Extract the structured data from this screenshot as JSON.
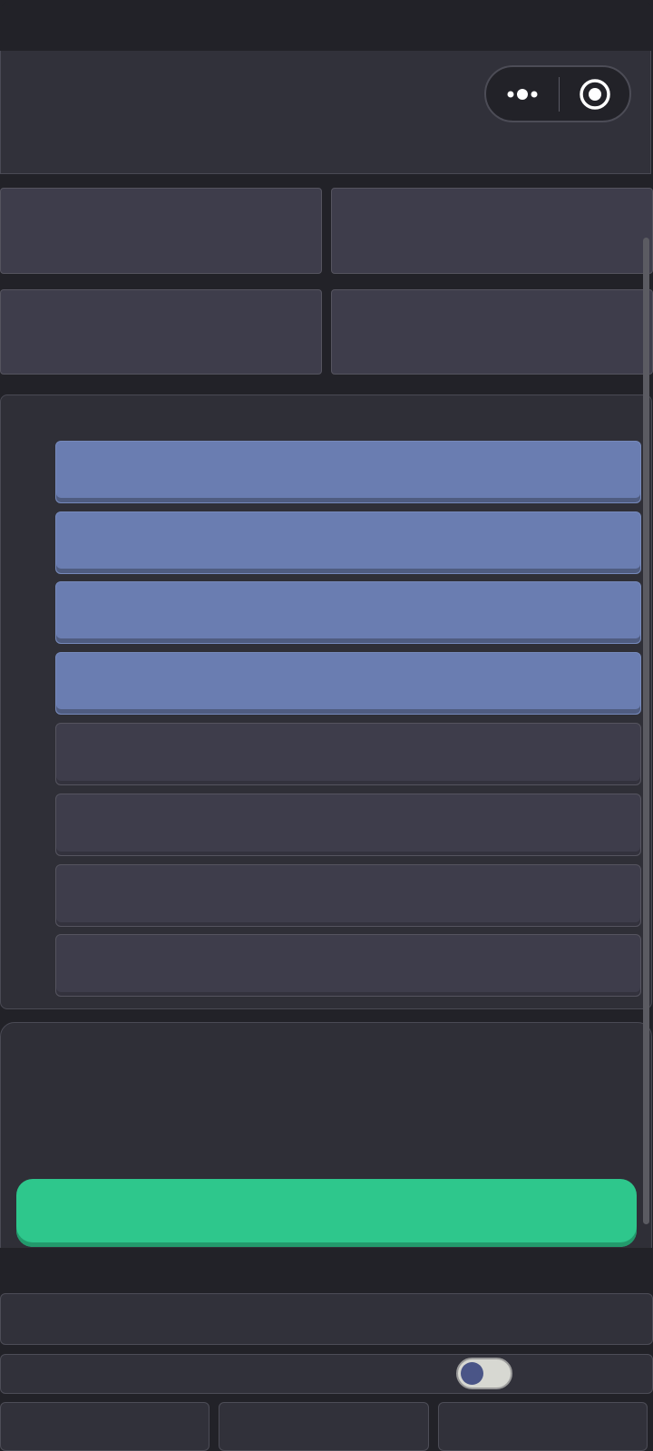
{
  "status_bar": {},
  "header": {
    "more_icon": "more-dots-icon",
    "close_icon": "target-circle-icon"
  },
  "tiles": [
    {},
    {},
    {},
    {}
  ],
  "list": {
    "rows": [
      {
        "state": "active"
      },
      {
        "state": "active"
      },
      {
        "state": "active"
      },
      {
        "state": "active"
      },
      {
        "state": "inactive"
      },
      {
        "state": "inactive"
      },
      {
        "state": "inactive"
      },
      {
        "state": "inactive"
      }
    ]
  },
  "action_panel": {
    "button_label": ""
  },
  "settings": {
    "toggle_on": false
  },
  "tabs": [
    {},
    {},
    {}
  ],
  "colors": {
    "background": "#222228",
    "panel": "#31313a",
    "tile": "#3e3d4b",
    "active_row": "#6a7db1",
    "primary_button": "#2ec78c",
    "toggle_knob": "#4a5587"
  }
}
